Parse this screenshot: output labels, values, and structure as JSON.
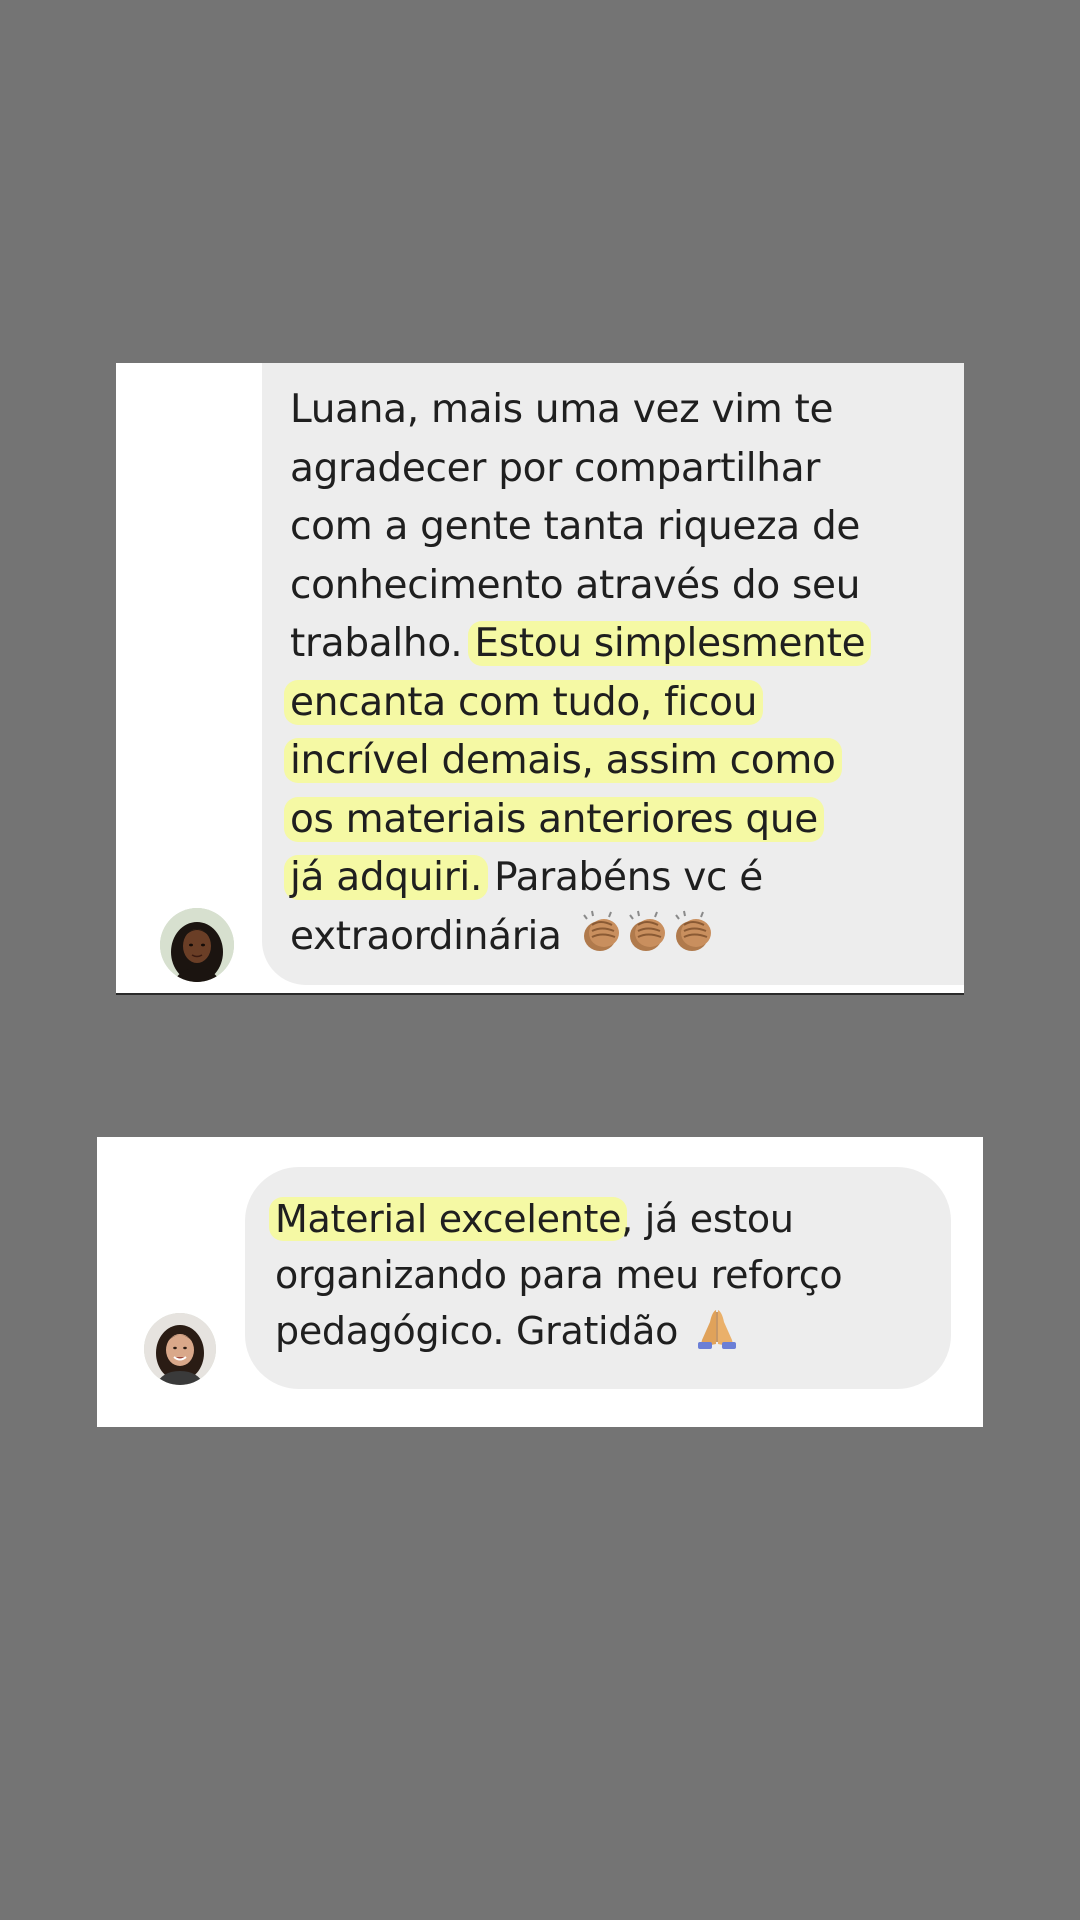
{
  "testimonials": [
    {
      "lines": [
        {
          "plain": "Luana, mais uma vez vim te",
          "highlight": ""
        },
        {
          "plain": "agradecer por compartilhar",
          "highlight": ""
        },
        {
          "plain": "com a gente tanta riqueza de",
          "highlight": ""
        },
        {
          "plain": "conhecimento através do seu",
          "highlight": ""
        },
        {
          "plain": "trabalho. ",
          "highlight": "Estou simplesmente"
        },
        {
          "plain": "",
          "highlight": "encanta com tudo, ficou"
        },
        {
          "plain": "",
          "highlight": "incrível demais, assim como"
        },
        {
          "plain": "",
          "highlight": "os materiais anteriores que"
        },
        {
          "plain": "",
          "highlight": "já adquiri.",
          "after": " Parabéns vc é"
        },
        {
          "plain": "extraordinária",
          "highlight": "",
          "emoji": "clapping-hands-x3"
        }
      ],
      "highlight_color": "#f6fa96"
    },
    {
      "lines": [
        {
          "plain": "",
          "highlight": "Material excelente",
          "after": ", já estou"
        },
        {
          "plain": "organizando para meu reforço",
          "highlight": ""
        },
        {
          "plain": "pedagógico. Gratidão",
          "highlight": "",
          "emoji": "praying-hands"
        }
      ],
      "highlight_color": "#f6fa96"
    }
  ],
  "colors": {
    "background": "#747474",
    "card": "#ffffff",
    "bubble": "#ededed",
    "text": "#1f1f1f",
    "highlight": "#f6fa96"
  },
  "icons": {
    "avatar_1": "profile-photo-woman-dark-hair",
    "avatar_2": "profile-photo-woman-smiling",
    "emoji_1": "clapping-hands-icon",
    "emoji_2": "praying-hands-icon"
  }
}
